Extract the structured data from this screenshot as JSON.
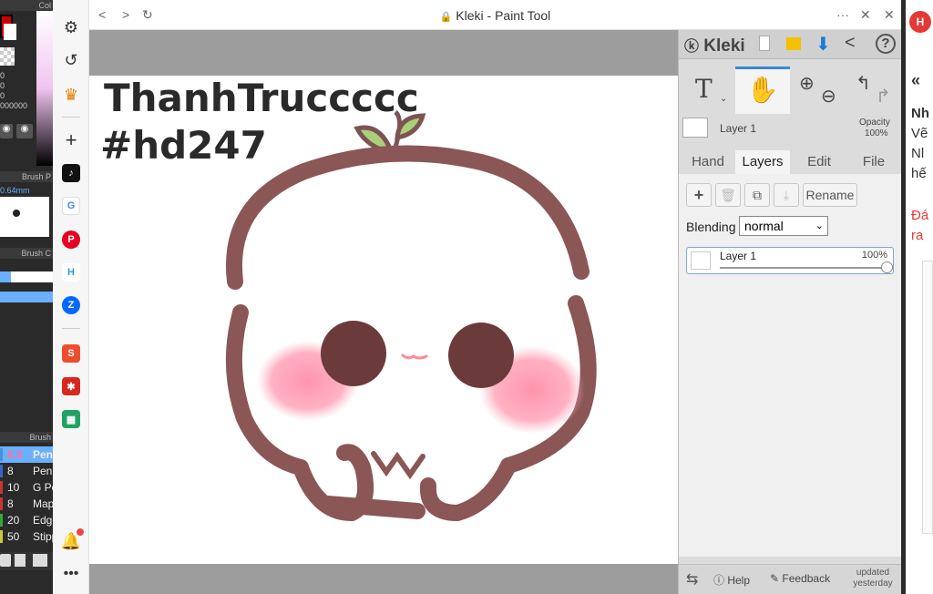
{
  "left_app": {
    "header_top": "Col",
    "numbers": [
      "0",
      "0",
      "0",
      "000000"
    ],
    "brush_preview_header": "Brush P",
    "brush_size": "0.64mm",
    "brush_color_header": "Brush C",
    "brushes_header": "Brush",
    "brushes": [
      {
        "size": "8.8",
        "name": "Pen",
        "color": "#4a90d9",
        "selected": true
      },
      {
        "size": "8",
        "name": "Pen",
        "color": "#3366cc",
        "selected": false
      },
      {
        "size": "10",
        "name": "G Pe",
        "color": "#cc3333",
        "selected": false
      },
      {
        "size": "8",
        "name": "Map",
        "color": "#cc3333",
        "selected": false
      },
      {
        "size": "20",
        "name": "Edge",
        "color": "#33aa33",
        "selected": false
      },
      {
        "size": "50",
        "name": "Stipp",
        "color": "#cccc33",
        "selected": false
      }
    ]
  },
  "sidebar": {
    "icons": [
      "gear-icon",
      "history-icon",
      "crown-icon",
      "plus-icon"
    ],
    "apps": [
      "tiktok",
      "google",
      "pinterest",
      "h-app",
      "zalo",
      "shopee",
      "games",
      "sheets"
    ],
    "bottom": [
      "bell-icon",
      "more-icon"
    ]
  },
  "window": {
    "title": "Kleki - Paint Tool",
    "lock_icon": "lock-icon"
  },
  "canvas": {
    "text_line1": "ThanhTruccccc",
    "text_line2": "#hd247"
  },
  "kleki": {
    "logo": "Kleki",
    "layer_name_top": "Layer 1",
    "opacity_label": "Opacity",
    "opacity_value": "100%",
    "tabs": [
      "Hand",
      "Layers",
      "Edit",
      "File"
    ],
    "active_tab": "Layers",
    "rename_label": "Rename",
    "blending_label": "Blending",
    "blending_value": "normal",
    "layer_item_name": "Layer 1",
    "layer_item_opacity": "100%",
    "layer_opacity_fraction": 1.0,
    "help_label": "Help",
    "feedback_label": "Feedback",
    "updated_line1": "updated",
    "updated_line2": "yesterday"
  },
  "right_page": {
    "line1": "Nh",
    "line2": "Vẽ",
    "line3": "Nl",
    "line4": "hế",
    "line5": "Đá",
    "line6": "ra"
  }
}
